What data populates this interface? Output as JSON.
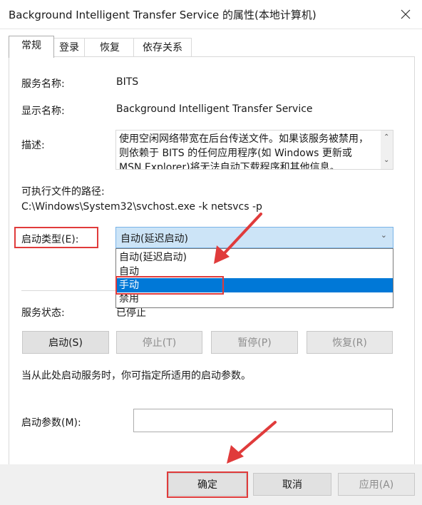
{
  "window": {
    "title": "Background Intelligent Transfer Service 的属性(本地计算机)"
  },
  "tabs": [
    "常规",
    "登录",
    "恢复",
    "依存关系"
  ],
  "general": {
    "service_name_label": "服务名称:",
    "service_name_value": "BITS",
    "display_name_label": "显示名称:",
    "display_name_value": "Background Intelligent Transfer Service",
    "description_label": "描述:",
    "description_text": "使用空闲网络带宽在后台传送文件。如果该服务被禁用，则依赖于 BITS 的任何应用程序(如 Windows 更新或 MSN Explorer)将无法自动下载程序和其他信息。",
    "path_label": "可执行文件的路径:",
    "path_value": "C:\\Windows\\System32\\svchost.exe -k netsvcs -p",
    "startup_type_label": "启动类型(E):",
    "startup_type_selected": "自动(延迟启动)",
    "startup_type_options": [
      "自动(延迟启动)",
      "自动",
      "手动",
      "禁用"
    ],
    "highlighted_option_index": 2,
    "service_status_label": "服务状态:",
    "service_status_value": "已停止",
    "buttons": {
      "start": "启动(S)",
      "stop": "停止(T)",
      "pause": "暂停(P)",
      "resume": "恢复(R)"
    },
    "hint_text": "当从此处启动服务时，你可指定所适用的启动参数。",
    "start_params_label": "启动参数(M):",
    "start_params_value": ""
  },
  "footer": {
    "ok": "确定",
    "cancel": "取消",
    "apply": "应用(A)"
  },
  "colors": {
    "annotation_red": "#e03b3b",
    "selection_blue": "#0078d7",
    "combo_highlight": "#cce4f7"
  }
}
